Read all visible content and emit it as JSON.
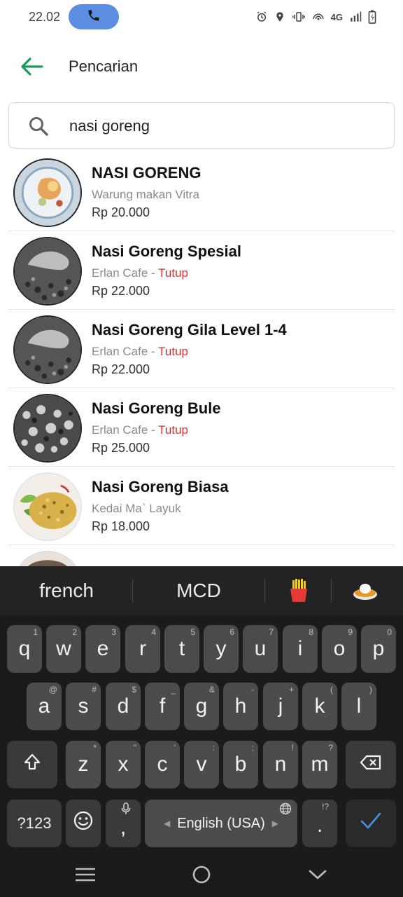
{
  "status_bar": {
    "time": "22.02",
    "network": "4G"
  },
  "header": {
    "title": "Pencarian"
  },
  "search": {
    "value": "nasi goreng"
  },
  "results": [
    {
      "name": "NASI GORENG",
      "store": "Warung makan Vitra",
      "status": "",
      "price": "Rp 20.000"
    },
    {
      "name": "Nasi Goreng Spesial",
      "store": "Erlan Cafe",
      "status": "Tutup",
      "price": "Rp 22.000"
    },
    {
      "name": "Nasi Goreng Gila Level 1-4",
      "store": "Erlan Cafe",
      "status": "Tutup",
      "price": "Rp 22.000"
    },
    {
      "name": "Nasi Goreng Bule",
      "store": "Erlan Cafe",
      "status": "Tutup",
      "price": "Rp 25.000"
    },
    {
      "name": "Nasi Goreng Biasa",
      "store": "Kedai Ma` Layuk",
      "status": "",
      "price": "Rp 18.000"
    }
  ],
  "separator": " - ",
  "keyboard": {
    "suggestions": [
      "french",
      "MCD"
    ],
    "emoji_suggestions": [
      "french-fries-emoji",
      "curry-rice-emoji"
    ],
    "row1": [
      {
        "key": "q",
        "hint": "1"
      },
      {
        "key": "w",
        "hint": "2"
      },
      {
        "key": "e",
        "hint": "3"
      },
      {
        "key": "r",
        "hint": "4"
      },
      {
        "key": "t",
        "hint": "5"
      },
      {
        "key": "y",
        "hint": "6"
      },
      {
        "key": "u",
        "hint": "7"
      },
      {
        "key": "i",
        "hint": "8"
      },
      {
        "key": "o",
        "hint": "9"
      },
      {
        "key": "p",
        "hint": "0"
      }
    ],
    "row2": [
      {
        "key": "a",
        "hint": "@"
      },
      {
        "key": "s",
        "hint": "#"
      },
      {
        "key": "d",
        "hint": "$"
      },
      {
        "key": "f",
        "hint": "_"
      },
      {
        "key": "g",
        "hint": "&"
      },
      {
        "key": "h",
        "hint": "-"
      },
      {
        "key": "j",
        "hint": "+"
      },
      {
        "key": "k",
        "hint": "("
      },
      {
        "key": "l",
        "hint": ")"
      }
    ],
    "row3": [
      {
        "key": "z",
        "hint": "*"
      },
      {
        "key": "x",
        "hint": "\""
      },
      {
        "key": "c",
        "hint": "'"
      },
      {
        "key": "v",
        "hint": ":"
      },
      {
        "key": "b",
        "hint": ";"
      },
      {
        "key": "n",
        "hint": "!"
      },
      {
        "key": "m",
        "hint": "?"
      }
    ],
    "symbols_label": "?123",
    "comma": ",",
    "space_label": "English (USA)",
    "period": ".",
    "period_hint": "!?"
  },
  "colors": {
    "accent_green": "#1b9a5a",
    "closed_red": "#d32f2f",
    "call_blue": "#5b8ee0",
    "enter_blue": "#4a8fe8"
  }
}
